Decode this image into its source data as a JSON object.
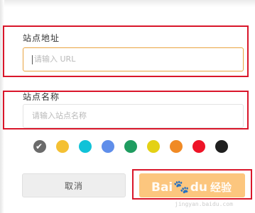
{
  "form": {
    "url_label": "站点地址",
    "url_placeholder": "请输入 URL",
    "name_label": "站点名称",
    "name_placeholder": "请输入站点名称"
  },
  "colors": [
    {
      "name": "gray",
      "hex": "#6b6b6b",
      "selected": true
    },
    {
      "name": "yellow",
      "hex": "#f4c033"
    },
    {
      "name": "cyan",
      "hex": "#10c2d8"
    },
    {
      "name": "blue",
      "hex": "#5f8eea"
    },
    {
      "name": "green",
      "hex": "#1f9c60"
    },
    {
      "name": "lime-yellow",
      "hex": "#e4d115"
    },
    {
      "name": "orange",
      "hex": "#f08a25"
    },
    {
      "name": "red",
      "hex": "#ee1427"
    },
    {
      "name": "black",
      "hex": "#1f1f1f"
    }
  ],
  "buttons": {
    "cancel_label": "取消"
  },
  "watermark": {
    "brand_left": "Bai",
    "brand_right": "du",
    "suffix": "经验",
    "url": "jingyan.baidu.com"
  },
  "annotation_color": "#d9162a"
}
